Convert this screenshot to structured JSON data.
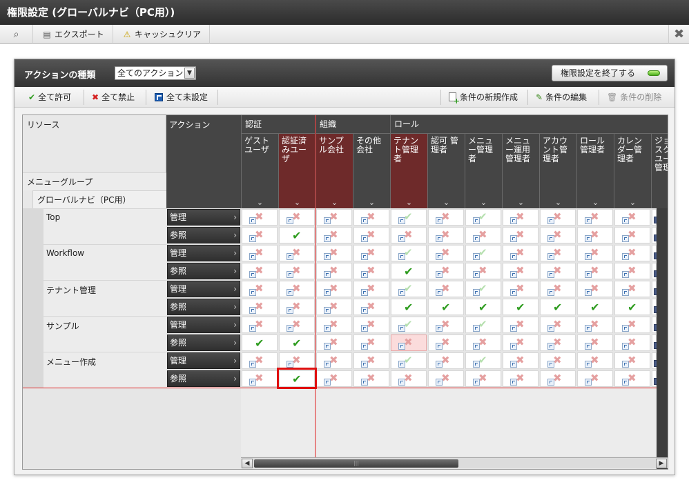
{
  "window": {
    "title": "権限設定 (グローバルナビ（PC用）)"
  },
  "toolbar": {
    "search_icon": "magnifier-icon",
    "export_label": "エクスポート",
    "cache_label": "キャッシュクリア",
    "close_symbol": "✖"
  },
  "panel": {
    "action_type_label": "アクションの種類",
    "action_select_value": "全てのアクション",
    "end_button_label": "権限設定を終了する"
  },
  "subbar": {
    "allow_all": "全て許可",
    "deny_all": "全て禁止",
    "unset_all": "全て未設定",
    "new_condition": "条件の新規作成",
    "edit_condition": "条件の編集",
    "delete_condition": "条件の削除"
  },
  "grid": {
    "resource_header": "リソース",
    "action_header": "アクション",
    "menu_group": "メニューグループ",
    "global_navi": "グローバルナビ（PC用）",
    "groups": [
      {
        "label": "認証"
      },
      {
        "label": "組織"
      },
      {
        "label": "ロール"
      }
    ],
    "columns": [
      {
        "label": "ゲスト\nユーザ"
      },
      {
        "label": "認証済\nみユー\nザ"
      },
      {
        "label": "サンプ\nル会社"
      },
      {
        "label": "その他\n会社"
      },
      {
        "label": "テナン\nト管理\n者"
      },
      {
        "label": "認可 管\n理者"
      },
      {
        "label": "メニュ\nー管理\n者"
      },
      {
        "label": "メニュ\nー運用\n管理者"
      },
      {
        "label": "アカウ\nント管\n理者"
      },
      {
        "label": "ロール\n管理者"
      },
      {
        "label": "カレン\nダー管\n理者"
      },
      {
        "label": "ジョ\nスク\nユー\n管理"
      }
    ],
    "resources": [
      {
        "name": "Top"
      },
      {
        "name": "Workflow"
      },
      {
        "name": "テナント管理"
      },
      {
        "name": "サンプル"
      },
      {
        "name": "メニュー作成"
      }
    ],
    "actions": {
      "manage": "管理",
      "view": "参照"
    }
  },
  "cells": [
    [
      "x",
      "x",
      "x",
      "x",
      "c",
      "x",
      "c",
      "x",
      "x",
      "x",
      "x"
    ],
    [
      "x",
      "B",
      "x",
      "x",
      "x",
      "x",
      "x",
      "x",
      "x",
      "x",
      "x"
    ],
    [
      "x",
      "x",
      "x",
      "x",
      "c",
      "x",
      "c",
      "x",
      "x",
      "x",
      "x"
    ],
    [
      "x",
      "x",
      "x",
      "x",
      "B",
      "x",
      "x",
      "x",
      "x",
      "x",
      "x"
    ],
    [
      "x",
      "x",
      "x",
      "x",
      "c",
      "x",
      "c",
      "x",
      "x",
      "x",
      "x"
    ],
    [
      "x",
      "x",
      "x",
      "x",
      "B",
      "B",
      "B",
      "B",
      "B",
      "B",
      "B"
    ],
    [
      "x",
      "x",
      "x",
      "x",
      "c",
      "x",
      "c",
      "x",
      "x",
      "x",
      "x"
    ],
    [
      "B",
      "B",
      "x",
      "x",
      "P",
      "x",
      "x",
      "x",
      "x",
      "x",
      "x"
    ],
    [
      "x",
      "x",
      "x",
      "x",
      "c",
      "x",
      "c",
      "x",
      "x",
      "x",
      "x"
    ],
    [
      "x",
      "B",
      "x",
      "x",
      "x",
      "x",
      "x",
      "x",
      "x",
      "x",
      "x"
    ]
  ]
}
